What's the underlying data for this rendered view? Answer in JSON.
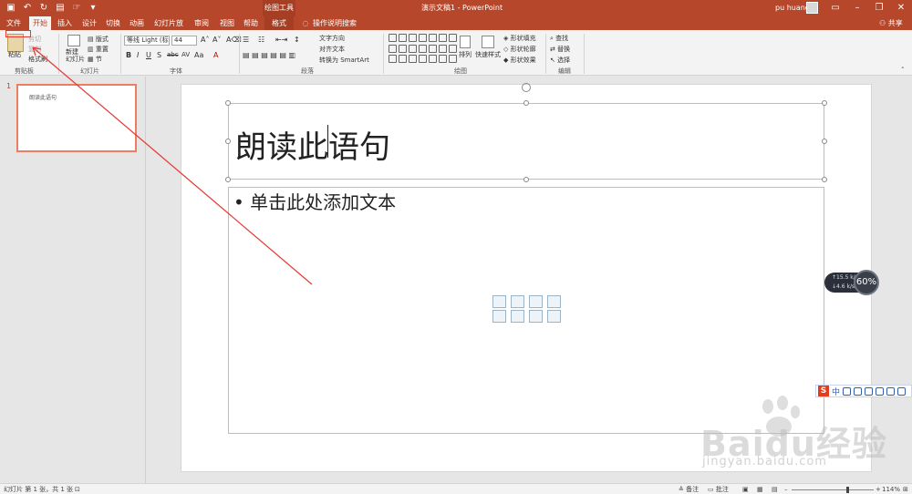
{
  "app": {
    "window_title": "演示文稿1  -  PowerPoint",
    "contextual_tools": "绘图工具",
    "user": "pu huang",
    "share": "共享",
    "tell_me": "操作说明搜索"
  },
  "tabs": [
    "文件",
    "开始",
    "插入",
    "设计",
    "切换",
    "动画",
    "幻灯片放映",
    "审阅",
    "视图",
    "帮助",
    "格式"
  ],
  "ribbon": {
    "clipboard": {
      "label": "剪贴板",
      "paste": "粘贴",
      "cut": "剪切",
      "copy": "复制",
      "format_painter": "格式刷"
    },
    "slides": {
      "label": "幻灯片",
      "new_slide": "新建\n幻灯片",
      "layout": "版式",
      "reset": "重置",
      "section": "节"
    },
    "font": {
      "label": "字体",
      "font_name": "等线 Light (标",
      "font_size": "44"
    },
    "paragraph": {
      "label": "段落",
      "text_direction": "文字方向",
      "align_text": "对齐文本",
      "smartart": "转换为 SmartArt"
    },
    "drawing": {
      "label": "绘图",
      "arrange": "排列",
      "quick_styles": "快速样式",
      "shape_fill": "形状填充",
      "shape_outline": "形状轮廓",
      "shape_effects": "形状效果"
    },
    "editing": {
      "label": "编辑",
      "find": "查找",
      "replace": "替换",
      "select": "选择"
    }
  },
  "thumbnails": [
    {
      "number": "1",
      "title": "朗读此语句"
    }
  ],
  "slide": {
    "title": "朗读此语句",
    "body_placeholder": "• 单击此处添加文本"
  },
  "net_widget": {
    "up": "↑15.5 k/s",
    "down": "↓4.6 k/s",
    "percent": "60%"
  },
  "ime": {
    "logo": "S",
    "mode": "中"
  },
  "watermark": {
    "brand": "Baidu经验",
    "url": "jingyan.baidu.com"
  },
  "statusbar": {
    "slide_info": "幻灯片 第 1 张，共 1 张",
    "notes": "备注",
    "comments": "批注",
    "zoom": "114%"
  },
  "colors": {
    "accent": "#b7472a",
    "annotation": "#e53935"
  }
}
